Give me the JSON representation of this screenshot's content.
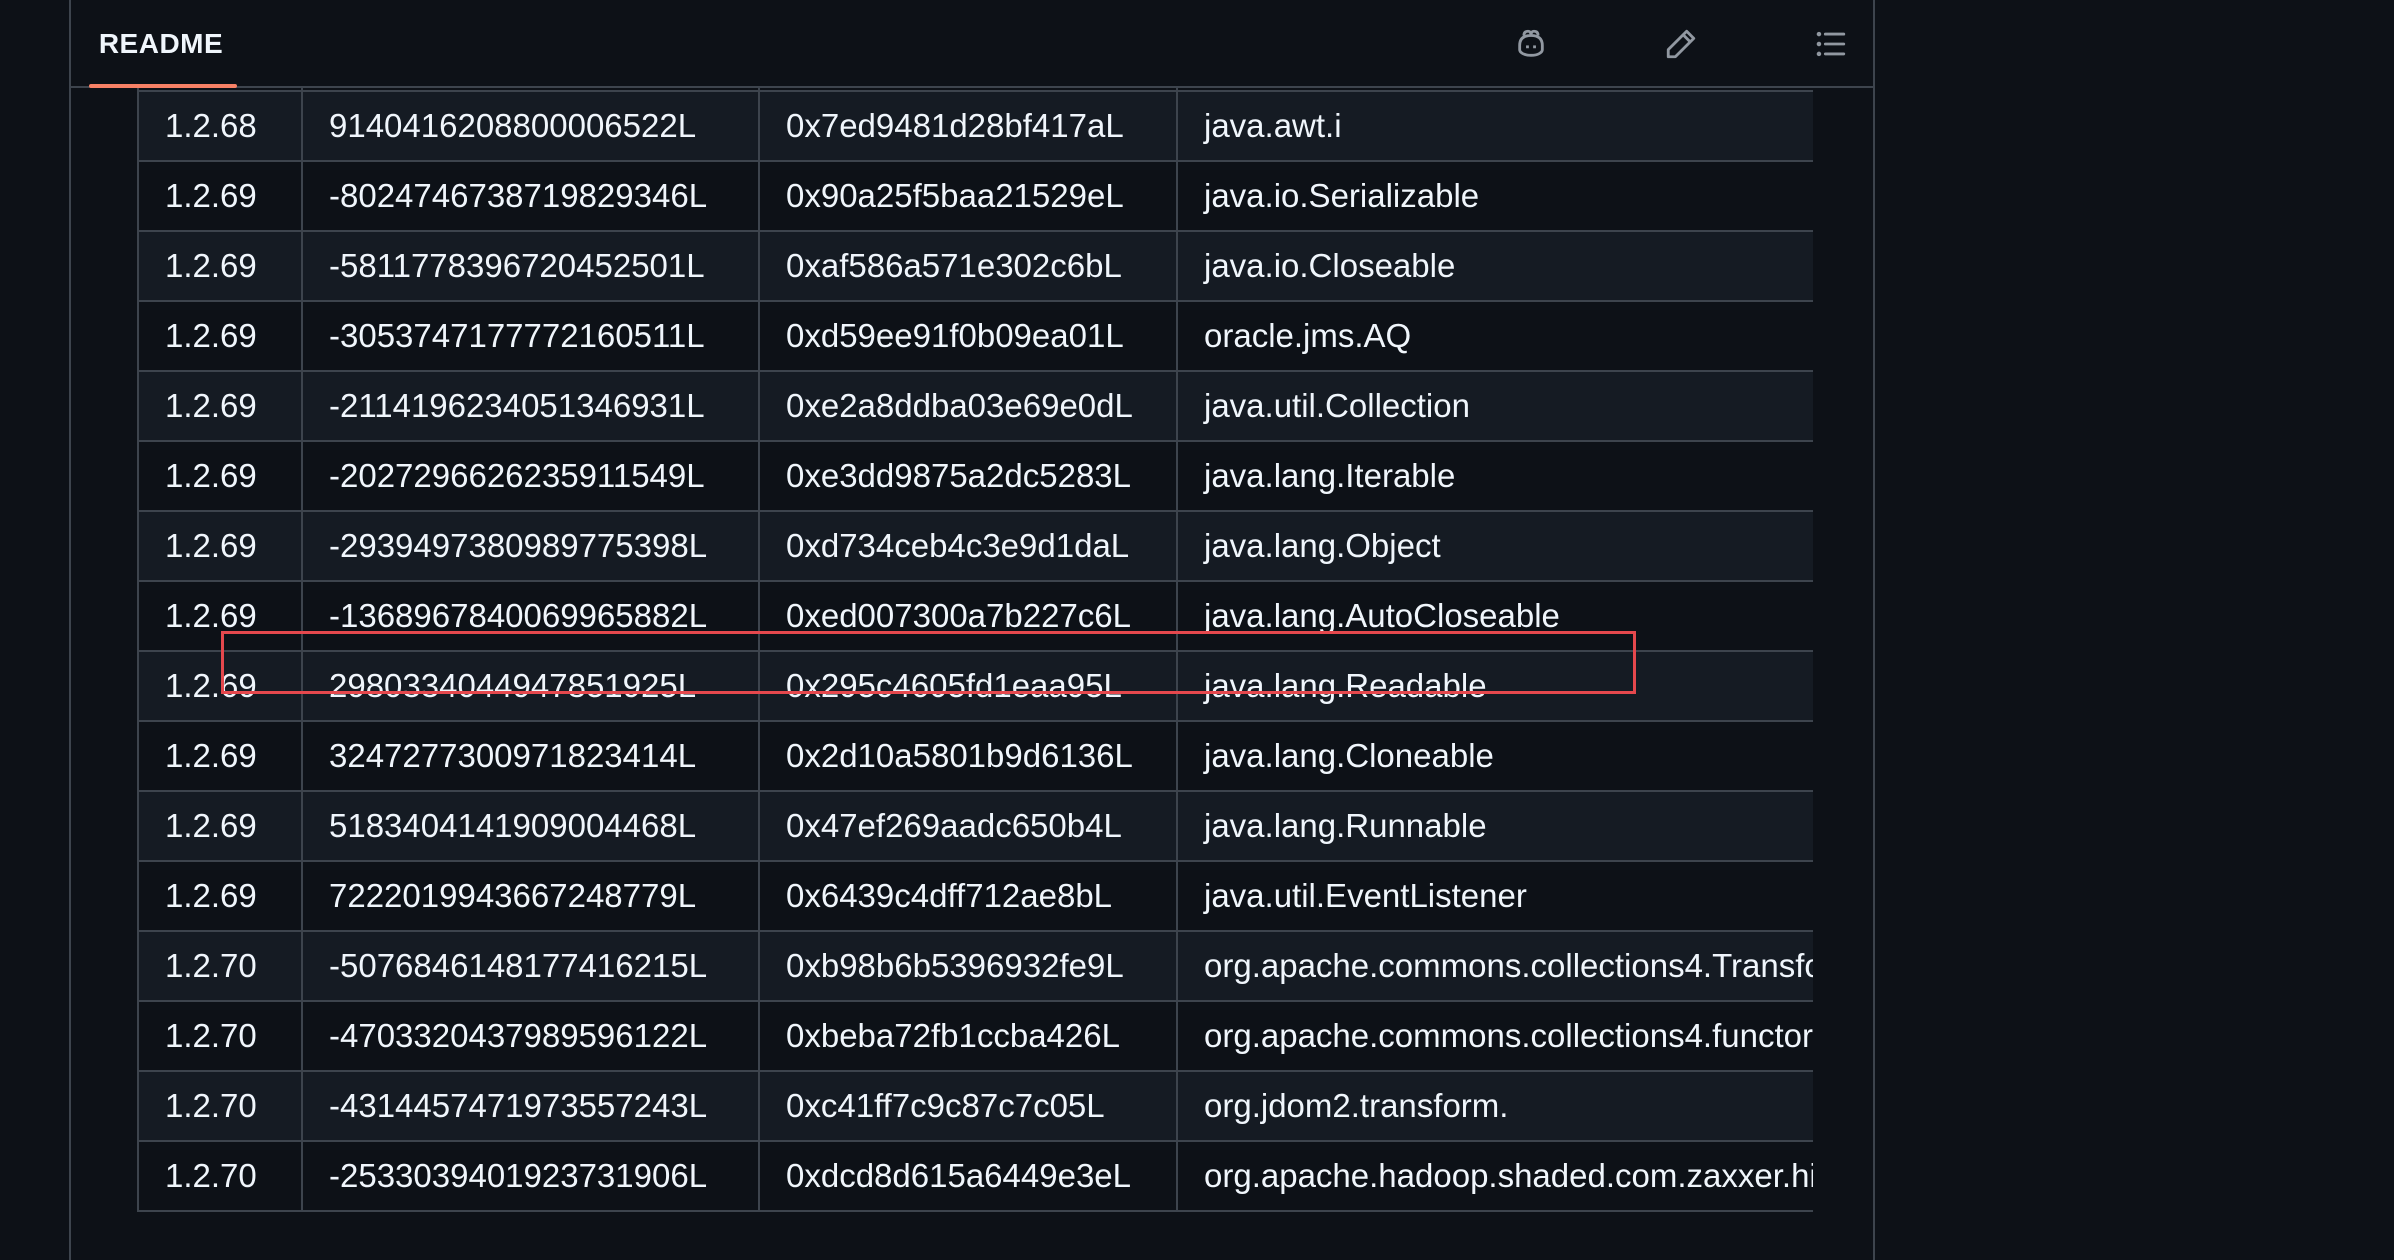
{
  "readme": {
    "tab_label": "README",
    "actions": [
      {
        "name": "copilot-icon"
      },
      {
        "name": "pencil-icon"
      },
      {
        "name": "list-icon"
      }
    ]
  },
  "table": {
    "rows": [
      [
        "",
        "",
        "",
        ""
      ],
      [
        "1.2.68",
        "9140416208800006522L",
        "0x7ed9481d28bf417aL",
        "java.awt.i"
      ],
      [
        "1.2.69",
        "-8024746738719829346L",
        "0x90a25f5baa21529eL",
        "java.io.Serializable"
      ],
      [
        "1.2.69",
        "-5811778396720452501L",
        "0xaf586a571e302c6bL",
        "java.io.Closeable"
      ],
      [
        "1.2.69",
        "-3053747177772160511L",
        "0xd59ee91f0b09ea01L",
        "oracle.jms.AQ"
      ],
      [
        "1.2.69",
        "-2114196234051346931L",
        "0xe2a8ddba03e69e0dL",
        "java.util.Collection"
      ],
      [
        "1.2.69",
        "-2027296626235911549L",
        "0xe3dd9875a2dc5283L",
        "java.lang.Iterable"
      ],
      [
        "1.2.69",
        "-2939497380989775398L",
        "0xd734ceb4c3e9d1daL",
        "java.lang.Object"
      ],
      [
        "1.2.69",
        "-1368967840069965882L",
        "0xed007300a7b227c6L",
        "java.lang.AutoCloseable"
      ],
      [
        "1.2.69",
        "2980334044947851925L",
        "0x295c4605fd1eaa95L",
        "java.lang.Readable"
      ],
      [
        "1.2.69",
        "3247277300971823414L",
        "0x2d10a5801b9d6136L",
        "java.lang.Cloneable"
      ],
      [
        "1.2.69",
        "5183404141909004468L",
        "0x47ef269aadc650b4L",
        "java.lang.Runnable"
      ],
      [
        "1.2.69",
        "7222019943667248779L",
        "0x6439c4dff712ae8bL",
        "java.util.EventListener"
      ],
      [
        "1.2.70",
        "-5076846148177416215L",
        "0xb98b6b5396932fe9L",
        "org.apache.commons.collections4.Transfo"
      ],
      [
        "1.2.70",
        "-4703320437989596122L",
        "0xbeba72fb1ccba426L",
        "org.apache.commons.collections4.functor"
      ],
      [
        "1.2.70",
        "-4314457471973557243L",
        "0xc41ff7c9c87c7c05L",
        "org.jdom2.transform."
      ],
      [
        "1.2.70",
        "-2533039401923731906L",
        "0xdcd8d615a6449e3eL",
        "org.apache.hadoop.shaded.com.zaxxer.hi"
      ]
    ],
    "highlighted_row_index": 8,
    "highlight_color": "#e5484d"
  }
}
